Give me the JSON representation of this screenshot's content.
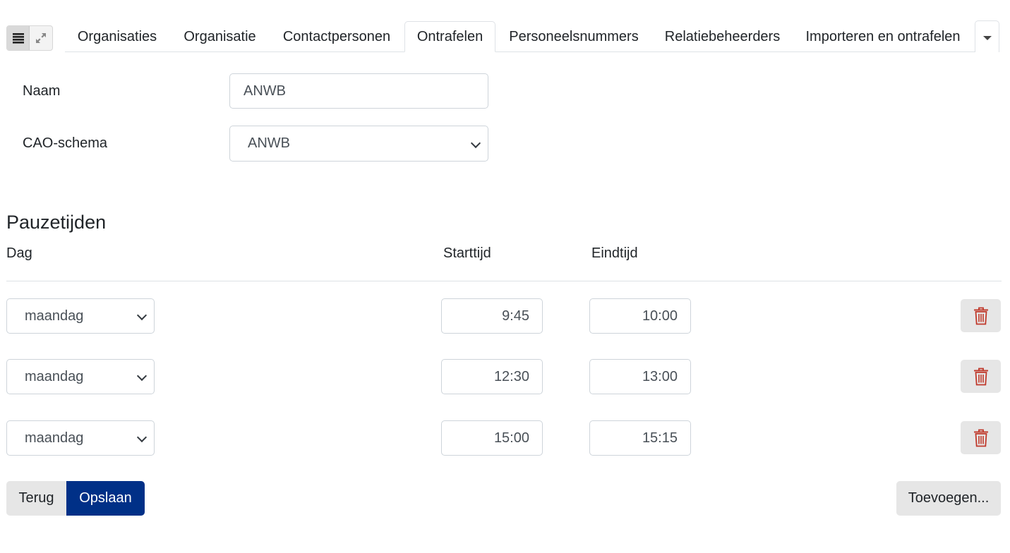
{
  "tabs": [
    {
      "label": "Organisaties",
      "active": false
    },
    {
      "label": "Organisatie",
      "active": false
    },
    {
      "label": "Contactpersonen",
      "active": false
    },
    {
      "label": "Ontrafelen",
      "active": true
    },
    {
      "label": "Personeelsnummers",
      "active": false
    },
    {
      "label": "Relatiebeheerders",
      "active": false
    },
    {
      "label": "Importeren en ontrafelen",
      "active": false
    }
  ],
  "form": {
    "naam_label": "Naam",
    "naam_value": "ANWB",
    "cao_label": "CAO-schema",
    "cao_value": "ANWB"
  },
  "pauzetijden": {
    "title": "Pauzetijden",
    "col_dag": "Dag",
    "col_start": "Starttijd",
    "col_end": "Eindtijd",
    "rows": [
      {
        "dag": "maandag",
        "start": "9:45",
        "end": "10:00"
      },
      {
        "dag": "maandag",
        "start": "12:30",
        "end": "13:00"
      },
      {
        "dag": "maandag",
        "start": "15:00",
        "end": "15:15"
      }
    ]
  },
  "buttons": {
    "back": "Terug",
    "save": "Opslaan",
    "add": "Toevoegen..."
  },
  "colors": {
    "primary": "#003087",
    "danger": "#c0392b"
  }
}
